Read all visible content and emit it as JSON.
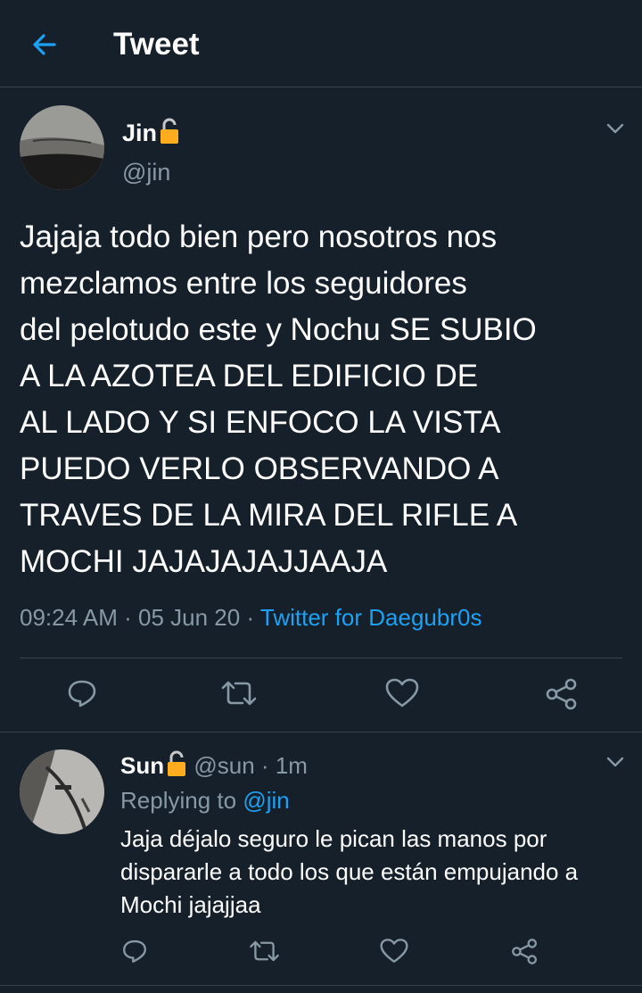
{
  "header": {
    "title": "Tweet",
    "back_icon": "arrow-left-icon",
    "accent": "#1da1f2"
  },
  "tweet": {
    "display_name": "Jin",
    "handle": "@jin",
    "text": "Jajaja todo bien pero nosotros nos\nmezclamos entre los seguidores\ndel pelotudo este y Nochu SE SUBIO\nA LA AZOTEA DEL EDIFICIO DE\nAL LADO Y SI ENFOCO LA VISTA\nPUEDO VERLO OBSERVANDO A\nTRAVES DE LA MIRA DEL RIFLE A\nMOCHI JAJAJAJAJJAAJA",
    "time": "09:24 AM",
    "sep1": "·",
    "date": "05 Jun 20",
    "sep2": "·",
    "source": "Twitter for Daegubr0s",
    "actions": [
      "reply-icon",
      "retweet-icon",
      "like-icon",
      "share-icon"
    ]
  },
  "reply": {
    "display_name": "Sun",
    "handle": "@sun",
    "sep": "·",
    "age": "1m",
    "replying_prefix": "Replying to",
    "replying_to": "@jin",
    "text": "Jaja déjalo seguro le pican las manos por\ndispararle a todo los que están empujando a\nMochi jajajjaa",
    "actions": [
      "reply-icon",
      "retweet-icon",
      "like-icon",
      "share-icon"
    ]
  },
  "colors": {
    "background": "#15202b",
    "muted": "#8899a6",
    "divider": "#38444d",
    "lock": "#ffad1f"
  }
}
